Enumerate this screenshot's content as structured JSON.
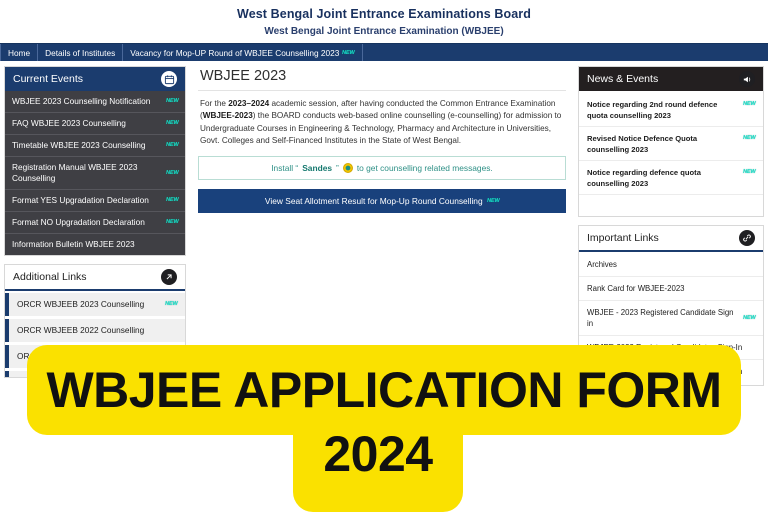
{
  "header": {
    "title": "West Bengal Joint Entrance Examinations Board",
    "subtitle": "West Bengal Joint Entrance Examination (WBJEE)"
  },
  "nav": {
    "items": [
      {
        "label": "Home",
        "badge": ""
      },
      {
        "label": "Details of Institutes",
        "badge": ""
      },
      {
        "label": "Vacancy for Mop-UP Round of WBJEE Counselling 2023",
        "badge": "NEW"
      }
    ]
  },
  "current_events": {
    "title": "Current Events",
    "icon": "calendar-icon",
    "items": [
      {
        "label": "WBJEE 2023 Counselling Notification",
        "badge": "NEW"
      },
      {
        "label": "FAQ WBJEE 2023 Counselling",
        "badge": "NEW"
      },
      {
        "label": "Timetable WBJEE 2023 Counselling",
        "badge": "NEW"
      },
      {
        "label": "Registration Manual WBJEE 2023 Counselling",
        "badge": "NEW"
      },
      {
        "label": "Format YES Upgradation Declaration",
        "badge": "NEW"
      },
      {
        "label": "Format NO Upgradation Declaration",
        "badge": "NEW"
      },
      {
        "label": "Information Bulletin WBJEE 2023",
        "badge": ""
      }
    ]
  },
  "additional_links": {
    "title": "Additional Links",
    "icon": "external-link-icon",
    "items": [
      {
        "label": "ORCR WBJEEB 2023 Counselling",
        "badge": "NEW"
      },
      {
        "label": "ORCR WBJEEB 2022 Counselling",
        "badge": ""
      },
      {
        "label": "ORCR WBJEEB 2021 Counselling",
        "badge": ""
      }
    ]
  },
  "main": {
    "title": "WBJEE 2023",
    "paragraph_parts": [
      {
        "text": "For the ",
        "bold": false
      },
      {
        "text": "2023–2024",
        "bold": true
      },
      {
        "text": " academic session, after having conducted the Common Entrance Examination (",
        "bold": false
      },
      {
        "text": "WBJEE-2023",
        "bold": true
      },
      {
        "text": ") the BOARD conducts web-based online counselling (e-counselling) for admission to Undergraduate Courses in Engineering & Technology, Pharmacy and Architecture in Universities, Govt. Colleges and Self-Financed Institutes in the State of West Bengal.",
        "bold": false
      }
    ],
    "install_bar": {
      "prefix": "Install “",
      "app_name": "Sandes",
      "suffix": "”",
      "icon": "sandes-app-icon",
      "tail": "to get counselling related messages."
    },
    "allotment_button": {
      "label": "View Seat Allotment Result for Mop-Up Round Counselling",
      "badge": "NEW"
    }
  },
  "news_events": {
    "title": "News & Events",
    "icon": "megaphone-icon",
    "items": [
      {
        "label": "Notice regarding 2nd round defence quota counselling 2023",
        "badge": "NEW"
      },
      {
        "label": "Revised Notice Defence Quota counselling 2023",
        "badge": "NEW"
      },
      {
        "label": "Notice regarding defence quota counselling 2023",
        "badge": "NEW"
      }
    ]
  },
  "important_links": {
    "title": "Important Links",
    "icon": "link-chain-icon",
    "items": [
      {
        "label": "Archives",
        "badge": ""
      },
      {
        "label": "Rank Card for WBJEE-2023",
        "badge": ""
      },
      {
        "label": "WBJEE - 2023 Registered Candidate Sign in",
        "badge": "NEW"
      },
      {
        "label": "WBJEE-2022 Registered Candidates Sign-In",
        "badge": ""
      },
      {
        "label": "WBJEE-2021 Registered Candidates Sign-In",
        "badge": ""
      }
    ]
  },
  "banner": {
    "line1": "WBJEE APPLICATION FORM",
    "line2": "2024",
    "background_color": "#fae100",
    "text_color": "#111111"
  },
  "colors": {
    "nav_blue": "#1b3c6e",
    "panel_dark": "#231f20",
    "list_dark": "#3f3f44",
    "badge_teal": "#17e0c8",
    "button_blue": "#19417c"
  }
}
